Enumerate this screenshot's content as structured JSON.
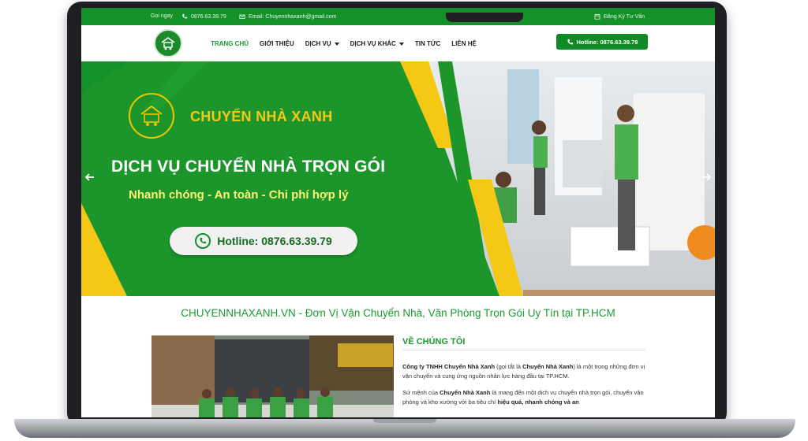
{
  "topbar": {
    "call_label": "Gọi ngay",
    "phone": "0876.63.39.79",
    "email": "Email: Chuyennhaxanh@gmail.com",
    "consult": "Đăng Ký Tư Vấn"
  },
  "nav": {
    "items": [
      {
        "label": "TRANG CHỦ",
        "dropdown": false
      },
      {
        "label": "GIỚI THIỆU",
        "dropdown": false
      },
      {
        "label": "DỊCH VỤ",
        "dropdown": true
      },
      {
        "label": "DỊCH VỤ KHÁC",
        "dropdown": true
      },
      {
        "label": "TIN TỨC",
        "dropdown": false
      },
      {
        "label": "LIÊN HỆ",
        "dropdown": false
      }
    ],
    "hotline_button": "Hotline: 0876.63.39.79"
  },
  "hero": {
    "brand": "CHUYỂN NHÀ XANH",
    "title": "DỊCH VỤ CHUYỂN NHÀ TRỌN GÓI",
    "subtitle": "Nhanh chóng - An toàn - Chi phí hợp lý",
    "hotline": "Hotline: 0876.63.39.79"
  },
  "tagline": "CHUYENNHAXANH.VN - Đơn Vị Vận Chuyển Nhà, Văn Phòng Trọn Gói Uy Tín tại TP.HCM",
  "about": {
    "heading": "VỀ CHÚNG TÔI",
    "p1_bold1": "Công ty TNHH Chuyển Nhà Xanh",
    "p1_text1": " (gọi tắt là ",
    "p1_bold2": "Chuyển Nhà Xanh",
    "p1_text2": ") là một trong những đơn vị vận chuyển và cung ứng nguồn nhân lực hàng đầu tại TP.HCM.",
    "p2_text1": "Sứ mệnh của ",
    "p2_bold1": "Chuyển Nhà Xanh",
    "p2_text2": " là mang đến một dịch vụ chuyển nhà trọn gói, chuyển văn phòng và kho xưởng với ba tiêu chí ",
    "p2_bold2": "hiệu quả, nhanh chóng và an"
  },
  "colors": {
    "brand_green": "#15912a",
    "accent_yellow": "#f6c816",
    "heading_green": "#1a9a31"
  }
}
